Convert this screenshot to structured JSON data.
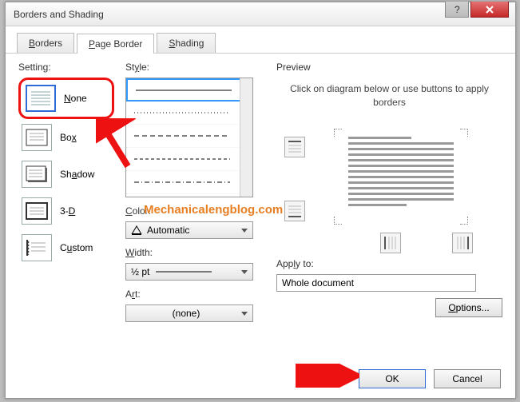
{
  "window": {
    "title": "Borders and Shading"
  },
  "tabs": {
    "borders": "Borders",
    "page_border": "Page Border",
    "shading": "Shading"
  },
  "setting": {
    "label": "Setting:",
    "items": [
      {
        "label": "None"
      },
      {
        "label": "Box"
      },
      {
        "label": "Shadow"
      },
      {
        "label": "3-D"
      },
      {
        "label": "Custom"
      }
    ]
  },
  "style": {
    "label": "Style:",
    "color_label": "Color:",
    "color_value": "Automatic",
    "width_label": "Width:",
    "width_value": "½ pt",
    "art_label": "Art:",
    "art_value": "(none)"
  },
  "preview": {
    "label": "Preview",
    "hint": "Click on diagram below or use buttons to apply borders",
    "apply_label": "Apply to:",
    "apply_value": "Whole document",
    "options_label": "Options..."
  },
  "buttons": {
    "ok": "OK",
    "cancel": "Cancel"
  },
  "watermark": "Mechanicalengblog.com"
}
